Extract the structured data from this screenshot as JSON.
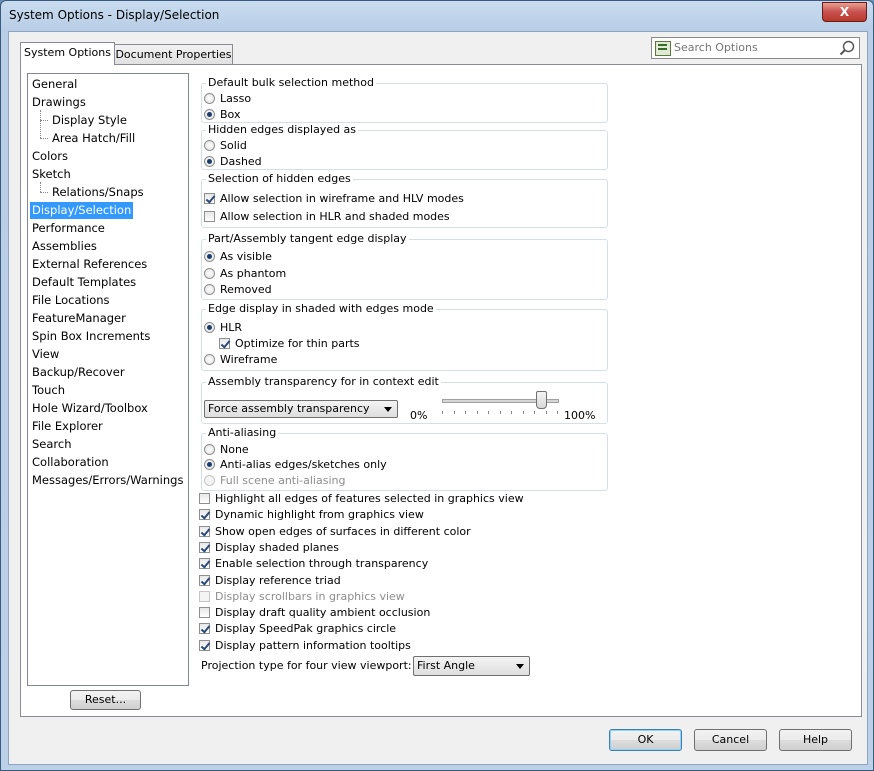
{
  "window": {
    "title": "System Options - Display/Selection",
    "close_label": "X"
  },
  "tabs": [
    {
      "label": "System Options",
      "active": true
    },
    {
      "label": "Document Properties",
      "active": false
    }
  ],
  "search": {
    "placeholder": "Search Options",
    "icon": "magnifier-icon"
  },
  "tree": {
    "items": [
      {
        "label": "General",
        "indent": 0
      },
      {
        "label": "Drawings",
        "indent": 0
      },
      {
        "label": "Display Style",
        "indent": 1
      },
      {
        "label": "Area Hatch/Fill",
        "indent": 1
      },
      {
        "label": "Colors",
        "indent": 0
      },
      {
        "label": "Sketch",
        "indent": 0
      },
      {
        "label": "Relations/Snaps",
        "indent": 1
      },
      {
        "label": "Display/Selection",
        "indent": 0,
        "selected": true
      },
      {
        "label": "Performance",
        "indent": 0
      },
      {
        "label": "Assemblies",
        "indent": 0
      },
      {
        "label": "External References",
        "indent": 0
      },
      {
        "label": "Default Templates",
        "indent": 0
      },
      {
        "label": "File Locations",
        "indent": 0
      },
      {
        "label": "FeatureManager",
        "indent": 0
      },
      {
        "label": "Spin Box Increments",
        "indent": 0
      },
      {
        "label": "View",
        "indent": 0
      },
      {
        "label": "Backup/Recover",
        "indent": 0
      },
      {
        "label": "Touch",
        "indent": 0
      },
      {
        "label": "Hole Wizard/Toolbox",
        "indent": 0
      },
      {
        "label": "File Explorer",
        "indent": 0
      },
      {
        "label": "Search",
        "indent": 0
      },
      {
        "label": "Collaboration",
        "indent": 0
      },
      {
        "label": "Messages/Errors/Warnings",
        "indent": 0
      }
    ],
    "reset_label": "Reset..."
  },
  "groups": {
    "bulk": {
      "title": "Default bulk selection method",
      "options": [
        {
          "label": "Lasso",
          "checked": false
        },
        {
          "label": "Box",
          "checked": true
        }
      ]
    },
    "hidden": {
      "title": "Hidden edges displayed as",
      "options": [
        {
          "label": "Solid",
          "checked": false
        },
        {
          "label": "Dashed",
          "checked": true
        }
      ]
    },
    "hidden_sel": {
      "title": "Selection of hidden edges",
      "options": [
        {
          "label": "Allow selection in wireframe and HLV modes",
          "checked": true
        },
        {
          "label": "Allow selection in HLR and shaded modes",
          "checked": false
        }
      ]
    },
    "tangent": {
      "title": "Part/Assembly tangent edge display",
      "options": [
        {
          "label": "As visible",
          "checked": true
        },
        {
          "label": "As phantom",
          "checked": false
        },
        {
          "label": "Removed",
          "checked": false
        }
      ]
    },
    "shaded_edges": {
      "title": "Edge display in shaded with edges mode",
      "hlr": {
        "label": "HLR",
        "checked": true
      },
      "thin": {
        "label": "Optimize for thin parts",
        "checked": true
      },
      "wire": {
        "label": "Wireframe",
        "checked": false
      }
    },
    "transparency": {
      "title": "Assembly transparency for in context edit",
      "combo_value": "Force assembly transparency",
      "min_label": "0%",
      "max_label": "100%",
      "slider_value": 0.85
    },
    "antialias": {
      "title": "Anti-aliasing",
      "options": [
        {
          "label": "None",
          "checked": false
        },
        {
          "label": "Anti-alias edges/sketches only",
          "checked": true
        },
        {
          "label": "Full scene anti-aliasing",
          "checked": false,
          "disabled": true
        }
      ]
    }
  },
  "checks": [
    {
      "label": "Highlight all edges of features selected in graphics view",
      "checked": false
    },
    {
      "label": "Dynamic highlight from graphics view",
      "checked": true
    },
    {
      "label": "Show open edges of surfaces in different color",
      "checked": true
    },
    {
      "label": "Display shaded planes",
      "checked": true
    },
    {
      "label": "Enable selection through transparency",
      "checked": true
    },
    {
      "label": "Display reference triad",
      "checked": true
    },
    {
      "label": "Display scrollbars in graphics view",
      "checked": false,
      "disabled": true
    },
    {
      "label": "Display draft quality ambient occlusion",
      "checked": false
    },
    {
      "label": "Display SpeedPak graphics circle",
      "checked": true
    },
    {
      "label": "Display pattern information tooltips",
      "checked": true
    }
  ],
  "projection": {
    "label": "Projection type for four view viewport:",
    "value": "First Angle"
  },
  "buttons": {
    "ok": "OK",
    "cancel": "Cancel",
    "help": "Help"
  }
}
